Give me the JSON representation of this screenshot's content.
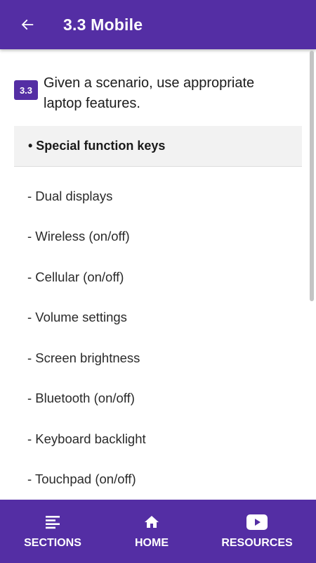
{
  "app_bar": {
    "title": "3.3 Mobile",
    "back_icon": "arrow-back-icon"
  },
  "objective": {
    "badge": "3.3",
    "text": "Given a scenario, use appropriate laptop features."
  },
  "highlight": {
    "label": "• Special function keys"
  },
  "items": [
    "- Dual displays",
    "- Wireless (on/off)",
    "- Cellular (on/off)",
    "- Volume settings",
    "- Screen brightness",
    "- Bluetooth (on/off)",
    "- Keyboard backlight",
    "- Touchpad (on/off)"
  ],
  "bottom_nav": {
    "sections": {
      "label": "SECTIONS",
      "icon": "list-icon"
    },
    "home": {
      "label": "HOME",
      "icon": "home-icon"
    },
    "resources": {
      "label": "RESOURCES",
      "icon": "play-icon"
    }
  },
  "colors": {
    "primary": "#542ea4",
    "highlight_bg": "#f2f2f2",
    "text": "#212121"
  }
}
